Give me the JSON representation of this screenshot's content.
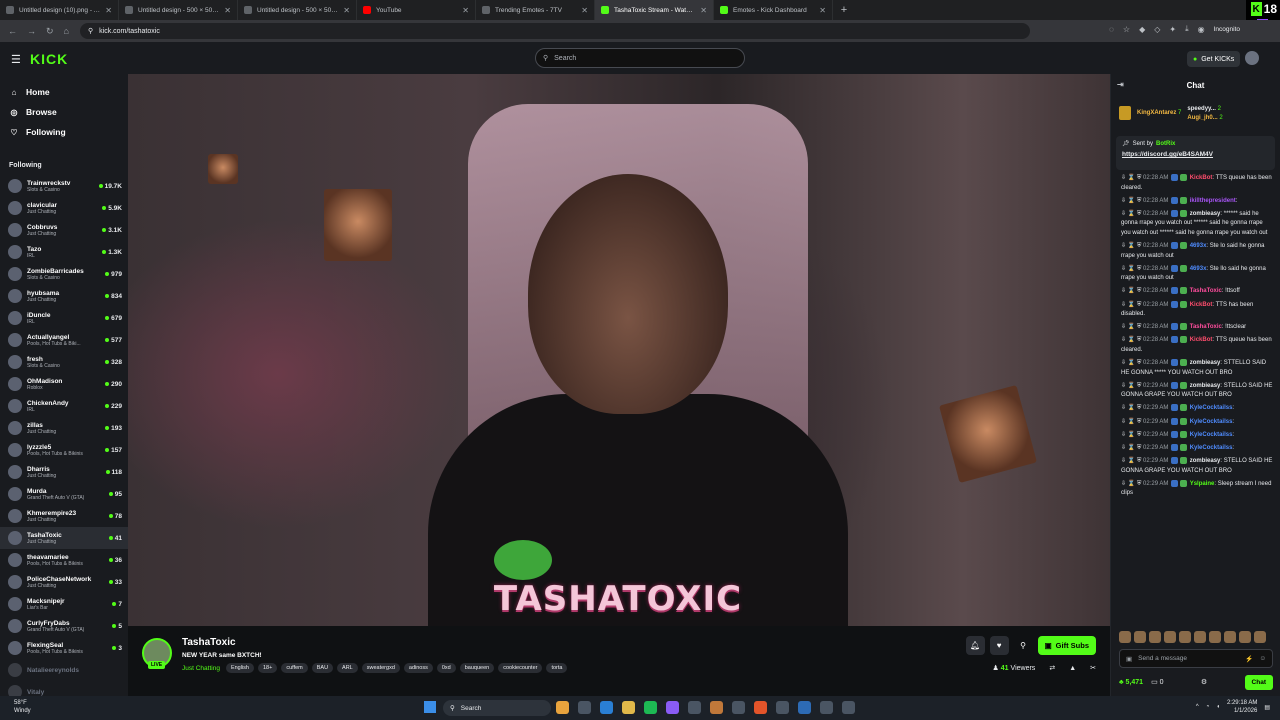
{
  "browser": {
    "tabs": [
      {
        "title": "Untitled design (10).png - Ani"
      },
      {
        "title": "Untitled design - 500 × 500px"
      },
      {
        "title": "Untitled design - 500 × 500px"
      },
      {
        "title": "YouTube"
      },
      {
        "title": "Trending Emotes - 7TV"
      },
      {
        "title": "TashaToxic Stream - Watch Live"
      },
      {
        "title": "Emotes - Kick Dashboard"
      }
    ],
    "active_tab": 5,
    "url": "kick.com/tashatoxic",
    "incognito_label": "Incognito",
    "badge_top": "18",
    "badge_bottom": "0"
  },
  "header": {
    "logo": "KICK",
    "search_placeholder": "Search",
    "get_kicks": "Get KICKs"
  },
  "sidebar": {
    "nav": [
      {
        "label": "Home",
        "icon": "home-icon"
      },
      {
        "label": "Browse",
        "icon": "compass-icon"
      },
      {
        "label": "Following",
        "icon": "heart-icon"
      }
    ],
    "following_heading": "Following",
    "channels": [
      {
        "name": "Trainwreckstv",
        "category": "Slots & Casino",
        "viewers": "19.7K"
      },
      {
        "name": "clavicular",
        "category": "Just Chatting",
        "viewers": "5.9K"
      },
      {
        "name": "Cobbruvs",
        "category": "Just Chatting",
        "viewers": "3.1K"
      },
      {
        "name": "Tazo",
        "category": "IRL",
        "viewers": "1.3K"
      },
      {
        "name": "ZombieBarricades",
        "category": "Slots & Casino",
        "viewers": "979"
      },
      {
        "name": "hyubsama",
        "category": "Just Chatting",
        "viewers": "834"
      },
      {
        "name": "iDuncle",
        "category": "IRL",
        "viewers": "679"
      },
      {
        "name": "Actuallyangel",
        "category": "Pools, Hot Tubs & Biki...",
        "viewers": "577"
      },
      {
        "name": "fresh",
        "category": "Slots & Casino",
        "viewers": "328"
      },
      {
        "name": "OhMadison",
        "category": "Roblox",
        "viewers": "290"
      },
      {
        "name": "ChickenAndy",
        "category": "IRL",
        "viewers": "229"
      },
      {
        "name": "zillas",
        "category": "Just Chatting",
        "viewers": "193"
      },
      {
        "name": "lyzzzle5",
        "category": "Pools, Hot Tubs & Bikinis",
        "viewers": "157"
      },
      {
        "name": "Dharris",
        "category": "Just Chatting",
        "viewers": "118"
      },
      {
        "name": "Murda",
        "category": "Grand Theft Auto V (GTA)",
        "viewers": "95"
      },
      {
        "name": "Khmerempire23",
        "category": "Just Chatting",
        "viewers": "78"
      },
      {
        "name": "TashaToxic",
        "category": "Just Chatting",
        "viewers": "41",
        "selected": true
      },
      {
        "name": "theavamariee",
        "category": "Pools, Hot Tubs & Bikinis",
        "viewers": "36"
      },
      {
        "name": "PoliceChaseNetwork",
        "category": "Just Chatting",
        "viewers": "33"
      },
      {
        "name": "Macksnipejr",
        "category": "Liar's Bar",
        "viewers": "7"
      },
      {
        "name": "CurlyFryDabs",
        "category": "Grand Theft Auto V (GTA)",
        "viewers": "5"
      },
      {
        "name": "FlexingSeal",
        "category": "Pools, Hot Tubs & Bikinis",
        "viewers": "3"
      }
    ],
    "offline": [
      {
        "name": "Natalieereynolds"
      },
      {
        "name": "Vitaly"
      }
    ]
  },
  "video": {
    "overlay_text": "TASHATOXIC"
  },
  "stream": {
    "name": "TashaToxic",
    "live_label": "LIVE",
    "title": "NEW YEAR same BXTCH!",
    "category": "Just Chatting",
    "tags": [
      "English",
      "18+",
      "cuffem",
      "BAU",
      "ARL",
      "sweatergxd",
      "adinoss",
      "0xd",
      "bauqueen",
      "cookiecounter",
      "torta"
    ],
    "gift_subs": "Gift Subs",
    "viewers_count": "41",
    "viewers_label": "Viewers"
  },
  "chat": {
    "title": "Chat",
    "top_gifters": [
      {
        "name": "KingXAntarez",
        "count": "7"
      },
      {
        "name": "speedyy...",
        "count": "2"
      },
      {
        "name": "Augi_jh0...",
        "count": "2"
      }
    ],
    "pinned": {
      "sent_by_label": "Sent by",
      "sent_by": "BotRix",
      "link": "https://discord.gg/eB4SAM4V"
    },
    "messages": [
      {
        "time": "02:28 AM",
        "user": "KickBot",
        "color": "#ff4d6d",
        "text": ": TTS queue has been cleared."
      },
      {
        "time": "02:28 AM",
        "user": "ikillthepresident",
        "color": "#a855f7",
        "text": ":"
      },
      {
        "time": "02:28 AM",
        "user": "zombieasy",
        "color": "#e8eaed",
        "text": ": ****** said he gonna rrape you watch out ****** said he gonna rrape you watch out ****** said he gonna rrape you watch out"
      },
      {
        "time": "02:28 AM",
        "user": "4693x",
        "color": "#4f8cff",
        "text": ": Ste lo said he gonna rrape you watch out"
      },
      {
        "time": "02:28 AM",
        "user": "4693x",
        "color": "#4f8cff",
        "text": ": Ste llo said he gonna rrape you watch out"
      },
      {
        "time": "02:28 AM",
        "user": "TashaToxic",
        "color": "#ff4d9d",
        "text": ": !ttsoff"
      },
      {
        "time": "02:28 AM",
        "user": "KickBot",
        "color": "#ff4d6d",
        "text": ": TTS has been disabled."
      },
      {
        "time": "02:28 AM",
        "user": "TashaToxic",
        "color": "#ff4d9d",
        "text": ": !ttsclear"
      },
      {
        "time": "02:28 AM",
        "user": "KickBot",
        "color": "#ff4d6d",
        "text": ": TTS queue has been cleared."
      },
      {
        "time": "02:28 AM",
        "user": "zombieasy",
        "color": "#e8eaed",
        "text": ": STTELLO SAID HE GONNA ***** YOU WATCH OUT BRO"
      },
      {
        "time": "02:29 AM",
        "user": "zombieasy",
        "color": "#e8eaed",
        "text": ": STELLO SAID HE GONNA GRAPE YOU WATCH OUT BRO"
      },
      {
        "time": "02:29 AM",
        "user": "KyleCocktailss",
        "color": "#4f8cff",
        "text": ":"
      },
      {
        "time": "02:29 AM",
        "user": "KyleCocktailss",
        "color": "#4f8cff",
        "text": ":"
      },
      {
        "time": "02:29 AM",
        "user": "KyleCocktailss",
        "color": "#4f8cff",
        "text": ":"
      },
      {
        "time": "02:29 AM",
        "user": "KyleCocktailss",
        "color": "#4f8cff",
        "text": ":"
      },
      {
        "time": "02:29 AM",
        "user": "zombieasy",
        "color": "#e8eaed",
        "text": ": STELLO SAID HE GONNA GRAPE YOU WATCH OUT BRO"
      },
      {
        "time": "02:29 AM",
        "user": "Yslpaine",
        "color": "#53fc18",
        "text": ": Sleep stream I need clips"
      }
    ],
    "send_placeholder": "Send a message",
    "kicks_balance": "5,471",
    "points": "0",
    "chat_button": "Chat"
  },
  "taskbar": {
    "weather_temp": "58°F",
    "weather_desc": "Windy",
    "search_placeholder": "Search",
    "time": "2:29:18 AM",
    "date": "1/1/2026"
  },
  "colors": {
    "kick_green": "#53fc18",
    "page_bg": "#191b1f"
  }
}
